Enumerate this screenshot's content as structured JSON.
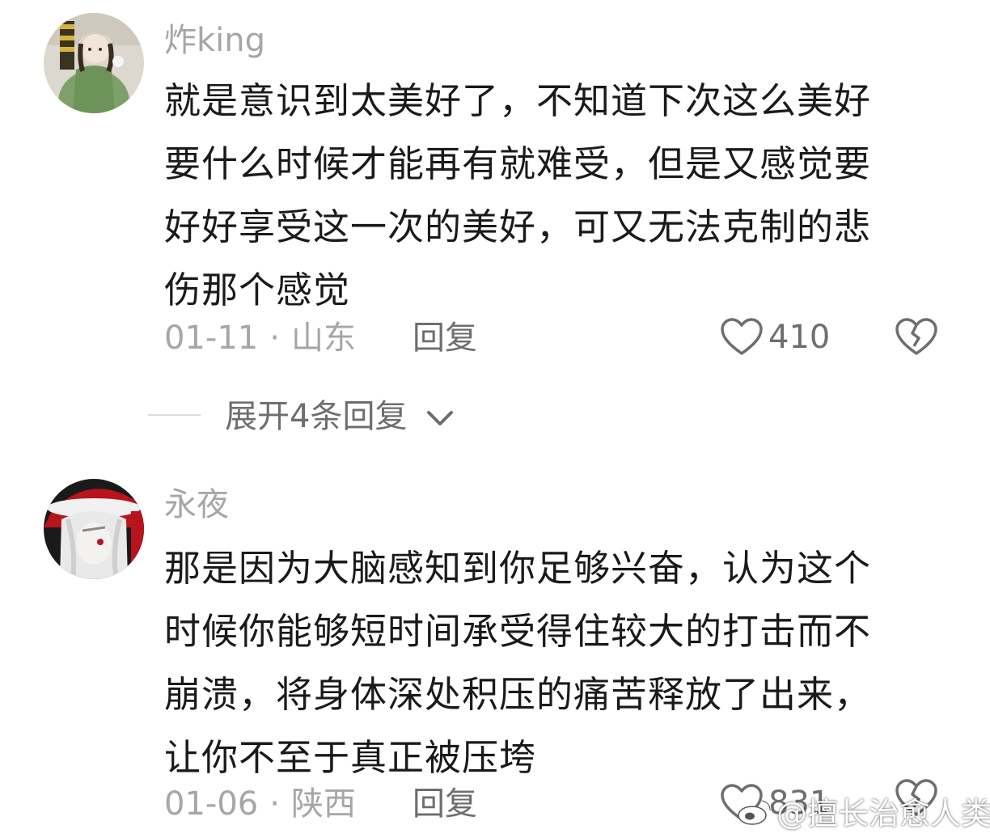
{
  "comments": [
    {
      "username": "炸king",
      "text_lines": [
        "就是意识到太美好了，不知道下次这么美好",
        "要什么时候才能再有就难受，但是又感觉要",
        "好好享受这一次的美好，可又无法克制的悲",
        "伤那个感觉"
      ],
      "date": "01-11",
      "separator": "·",
      "location": "山东",
      "reply_label": "回复",
      "likes": "410",
      "avatar_icon": "avatar-girl-green-jacket"
    },
    {
      "username": "永夜",
      "text_lines": [
        "那是因为大脑感知到你足够兴奋，认为这个",
        "时候你能够短时间承受得住较大的打击而不",
        "崩溃，将身体深处积压的痛苦释放了出来，",
        "让你不至于真正被压垮"
      ],
      "date": "01-06",
      "separator": "·",
      "location": "陕西",
      "reply_label": "回复",
      "likes": "831",
      "avatar_icon": "avatar-anime-santa-hat"
    }
  ],
  "expand_replies": {
    "label": "展开4条回复",
    "icon": "chevron-down-icon"
  },
  "watermark": {
    "text": "@擅长治愈人类",
    "icon": "weibo-logo-icon"
  },
  "colors": {
    "username": "#a6a6a6",
    "body_text": "#1a1a1a",
    "meta": "#a6a6a6",
    "action": "#6e6e6e",
    "divider": "#dcdcdc"
  }
}
